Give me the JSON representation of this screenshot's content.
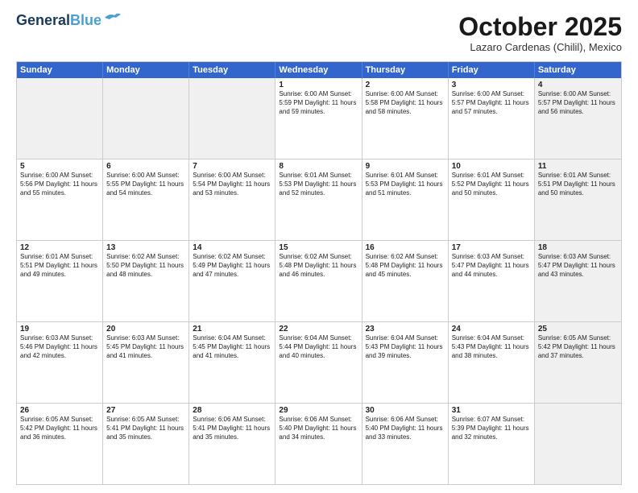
{
  "header": {
    "logo_line1": "General",
    "logo_line2": "Blue",
    "month": "October 2025",
    "location": "Lazaro Cardenas (Chilil), Mexico"
  },
  "days_of_week": [
    "Sunday",
    "Monday",
    "Tuesday",
    "Wednesday",
    "Thursday",
    "Friday",
    "Saturday"
  ],
  "weeks": [
    [
      {
        "day": "",
        "text": "",
        "shaded": true
      },
      {
        "day": "",
        "text": "",
        "shaded": true
      },
      {
        "day": "",
        "text": "",
        "shaded": true
      },
      {
        "day": "1",
        "text": "Sunrise: 6:00 AM\nSunset: 5:59 PM\nDaylight: 11 hours\nand 59 minutes."
      },
      {
        "day": "2",
        "text": "Sunrise: 6:00 AM\nSunset: 5:58 PM\nDaylight: 11 hours\nand 58 minutes."
      },
      {
        "day": "3",
        "text": "Sunrise: 6:00 AM\nSunset: 5:57 PM\nDaylight: 11 hours\nand 57 minutes."
      },
      {
        "day": "4",
        "text": "Sunrise: 6:00 AM\nSunset: 5:57 PM\nDaylight: 11 hours\nand 56 minutes.",
        "shaded": true
      }
    ],
    [
      {
        "day": "5",
        "text": "Sunrise: 6:00 AM\nSunset: 5:56 PM\nDaylight: 11 hours\nand 55 minutes."
      },
      {
        "day": "6",
        "text": "Sunrise: 6:00 AM\nSunset: 5:55 PM\nDaylight: 11 hours\nand 54 minutes."
      },
      {
        "day": "7",
        "text": "Sunrise: 6:00 AM\nSunset: 5:54 PM\nDaylight: 11 hours\nand 53 minutes."
      },
      {
        "day": "8",
        "text": "Sunrise: 6:01 AM\nSunset: 5:53 PM\nDaylight: 11 hours\nand 52 minutes."
      },
      {
        "day": "9",
        "text": "Sunrise: 6:01 AM\nSunset: 5:53 PM\nDaylight: 11 hours\nand 51 minutes."
      },
      {
        "day": "10",
        "text": "Sunrise: 6:01 AM\nSunset: 5:52 PM\nDaylight: 11 hours\nand 50 minutes."
      },
      {
        "day": "11",
        "text": "Sunrise: 6:01 AM\nSunset: 5:51 PM\nDaylight: 11 hours\nand 50 minutes.",
        "shaded": true
      }
    ],
    [
      {
        "day": "12",
        "text": "Sunrise: 6:01 AM\nSunset: 5:51 PM\nDaylight: 11 hours\nand 49 minutes."
      },
      {
        "day": "13",
        "text": "Sunrise: 6:02 AM\nSunset: 5:50 PM\nDaylight: 11 hours\nand 48 minutes."
      },
      {
        "day": "14",
        "text": "Sunrise: 6:02 AM\nSunset: 5:49 PM\nDaylight: 11 hours\nand 47 minutes."
      },
      {
        "day": "15",
        "text": "Sunrise: 6:02 AM\nSunset: 5:48 PM\nDaylight: 11 hours\nand 46 minutes."
      },
      {
        "day": "16",
        "text": "Sunrise: 6:02 AM\nSunset: 5:48 PM\nDaylight: 11 hours\nand 45 minutes."
      },
      {
        "day": "17",
        "text": "Sunrise: 6:03 AM\nSunset: 5:47 PM\nDaylight: 11 hours\nand 44 minutes."
      },
      {
        "day": "18",
        "text": "Sunrise: 6:03 AM\nSunset: 5:47 PM\nDaylight: 11 hours\nand 43 minutes.",
        "shaded": true
      }
    ],
    [
      {
        "day": "19",
        "text": "Sunrise: 6:03 AM\nSunset: 5:46 PM\nDaylight: 11 hours\nand 42 minutes."
      },
      {
        "day": "20",
        "text": "Sunrise: 6:03 AM\nSunset: 5:45 PM\nDaylight: 11 hours\nand 41 minutes."
      },
      {
        "day": "21",
        "text": "Sunrise: 6:04 AM\nSunset: 5:45 PM\nDaylight: 11 hours\nand 41 minutes."
      },
      {
        "day": "22",
        "text": "Sunrise: 6:04 AM\nSunset: 5:44 PM\nDaylight: 11 hours\nand 40 minutes."
      },
      {
        "day": "23",
        "text": "Sunrise: 6:04 AM\nSunset: 5:43 PM\nDaylight: 11 hours\nand 39 minutes."
      },
      {
        "day": "24",
        "text": "Sunrise: 6:04 AM\nSunset: 5:43 PM\nDaylight: 11 hours\nand 38 minutes."
      },
      {
        "day": "25",
        "text": "Sunrise: 6:05 AM\nSunset: 5:42 PM\nDaylight: 11 hours\nand 37 minutes.",
        "shaded": true
      }
    ],
    [
      {
        "day": "26",
        "text": "Sunrise: 6:05 AM\nSunset: 5:42 PM\nDaylight: 11 hours\nand 36 minutes."
      },
      {
        "day": "27",
        "text": "Sunrise: 6:05 AM\nSunset: 5:41 PM\nDaylight: 11 hours\nand 35 minutes."
      },
      {
        "day": "28",
        "text": "Sunrise: 6:06 AM\nSunset: 5:41 PM\nDaylight: 11 hours\nand 35 minutes."
      },
      {
        "day": "29",
        "text": "Sunrise: 6:06 AM\nSunset: 5:40 PM\nDaylight: 11 hours\nand 34 minutes."
      },
      {
        "day": "30",
        "text": "Sunrise: 6:06 AM\nSunset: 5:40 PM\nDaylight: 11 hours\nand 33 minutes."
      },
      {
        "day": "31",
        "text": "Sunrise: 6:07 AM\nSunset: 5:39 PM\nDaylight: 11 hours\nand 32 minutes."
      },
      {
        "day": "",
        "text": "",
        "shaded": true
      }
    ]
  ]
}
